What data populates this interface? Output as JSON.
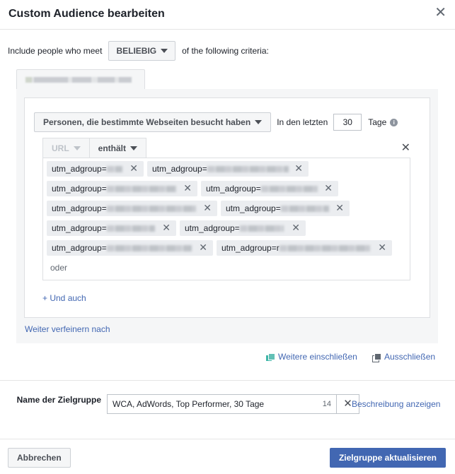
{
  "dialog": {
    "title": "Custom Audience bearbeiten"
  },
  "criteria": {
    "prefix": "Include people who meet",
    "match_value": "BELIEBIG",
    "suffix": "of the following criteria:"
  },
  "rule": {
    "event_select": "Personen, die bestimmte Webseiten besucht haben",
    "days_label": "In den letzten",
    "days_value": "30",
    "tage_label": "Tage",
    "field_select": "URL",
    "operator_select": "enthält",
    "tags": [
      "utm_adgroup=",
      "utm_adgroup=",
      "utm_adgroup=",
      "utm_adgroup=",
      "utm_adgroup=",
      "utm_adgroup=",
      "utm_adgroup=",
      "utm_adgroup=",
      "utm_adgroup=",
      "utm_adgroup=r"
    ],
    "or_placeholder": "oder",
    "and_link": "+ Und auch"
  },
  "refine_link": "Weiter verfeinern nach",
  "include_more_link": "Weitere einschließen",
  "exclude_link": "Ausschließen",
  "name": {
    "label": "Name der Zielgruppe",
    "value": "WCA, AdWords, Top Performer, 30 Tage",
    "count": "14",
    "description_link": "Beschreibung anzeigen"
  },
  "footer": {
    "cancel_label": "Abbrechen",
    "update_label": "Zielgruppe aktualisieren"
  },
  "colors": {
    "link": "#4267b2",
    "primary_button": "#4267b2",
    "panel_bg": "#f5f6f7"
  }
}
